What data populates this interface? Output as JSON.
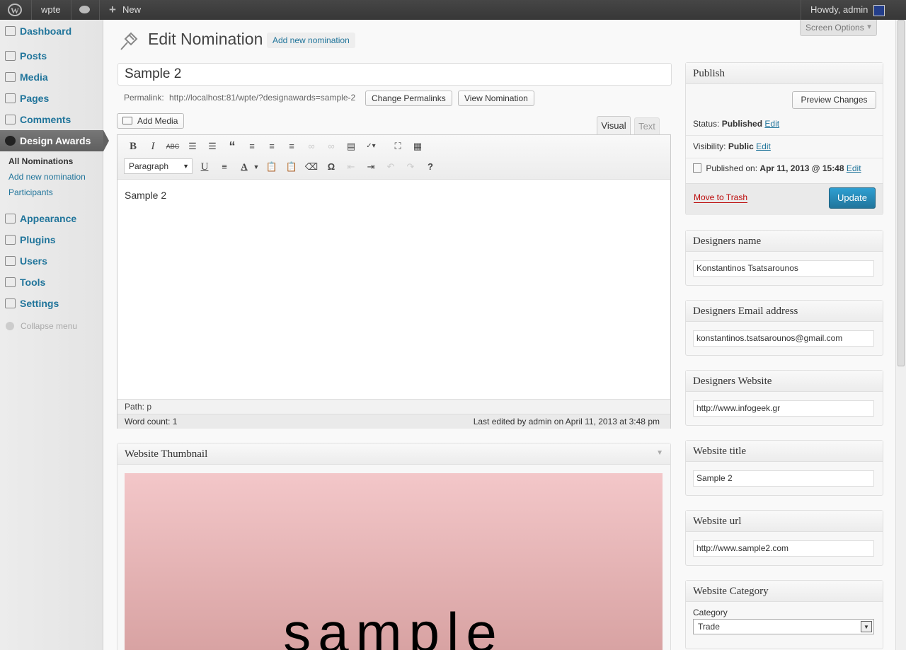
{
  "adminbar": {
    "site": "wpte",
    "new": "New",
    "howdy": "Howdy, admin"
  },
  "sidebar": {
    "items": [
      {
        "label": "Dashboard"
      },
      {
        "label": "Posts"
      },
      {
        "label": "Media"
      },
      {
        "label": "Pages"
      },
      {
        "label": "Comments"
      },
      {
        "label": "Design Awards"
      },
      {
        "label": "Appearance"
      },
      {
        "label": "Plugins"
      },
      {
        "label": "Users"
      },
      {
        "label": "Tools"
      },
      {
        "label": "Settings"
      }
    ],
    "submenu": [
      "All Nominations",
      "Add new nomination",
      "Participants"
    ],
    "collapse": "Collapse menu"
  },
  "header": {
    "title": "Edit Nomination",
    "add_new": "Add new nomination",
    "screen_options": "Screen Options"
  },
  "post": {
    "title": "Sample 2",
    "permalink_label": "Permalink:",
    "permalink_url": "http://localhost:81/wpte/?designawards=sample-2",
    "change_permalinks": "Change Permalinks",
    "view": "View Nomination",
    "add_media": "Add Media",
    "tab_visual": "Visual",
    "tab_text": "Text",
    "format": "Paragraph",
    "content": "Sample 2",
    "path": "Path: p",
    "word_count": "Word count: 1",
    "last_edited": "Last edited by admin on April 11, 2013 at 3:48 pm"
  },
  "thumbnail": {
    "title": "Website Thumbnail",
    "image_text": "sample"
  },
  "publish": {
    "title": "Publish",
    "preview": "Preview Changes",
    "status_label": "Status:",
    "status": "Published",
    "edit": "Edit",
    "visibility_label": "Visibility:",
    "visibility": "Public",
    "published_label": "Published on:",
    "published": "Apr 11, 2013 @ 15:48",
    "trash": "Move to Trash",
    "update": "Update"
  },
  "boxes": [
    {
      "title": "Designers name",
      "value": "Konstantinos Tsatsarounos"
    },
    {
      "title": "Designers Email address",
      "value": "konstantinos.tsatsarounos@gmail.com"
    },
    {
      "title": "Designers Website",
      "value": "http://www.infogeek.gr"
    },
    {
      "title": "Website title",
      "value": "Sample 2"
    },
    {
      "title": "Website url",
      "value": "http://www.sample2.com"
    }
  ],
  "category": {
    "title": "Website Category",
    "label": "Category",
    "value": "Trade"
  },
  "colors": {
    "accent": "#21759b",
    "update": "#2a8bbf",
    "trash": "#bc0b0b"
  }
}
